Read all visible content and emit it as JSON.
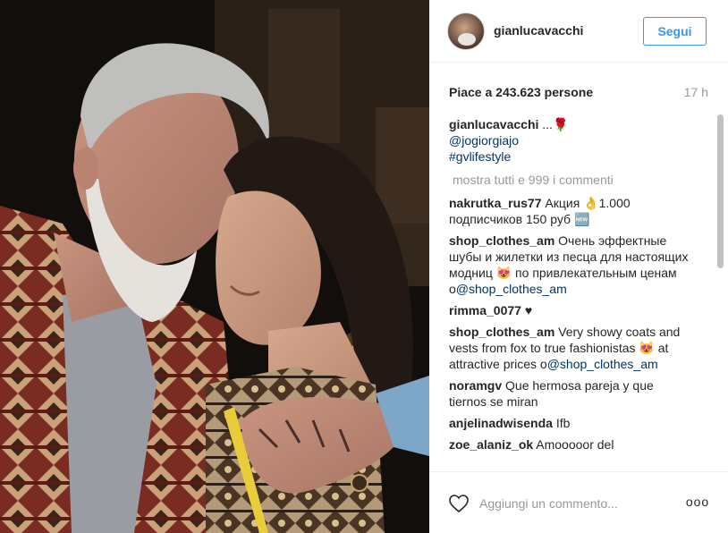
{
  "post": {
    "username": "gianlucavacchi",
    "follow_label": "Segui",
    "likes_text": "Piace a 243.623 persone",
    "time_ago": "17 h"
  },
  "caption": {
    "username": "gianlucavacchi",
    "text": " ...",
    "emoji": "🌹",
    "mention": "@jogiorgiajo",
    "hashtag": "#gvlifestyle"
  },
  "load_more": "mostra tutti e 999 i commenti",
  "comments": [
    {
      "user": "nakrutka_rus77",
      "text": " Акция ",
      "emoji1": "👌",
      "text2": "1.000 подписчиков 150 руб ",
      "emoji2": "🆕"
    },
    {
      "user": "shop_clothes_am",
      "text": " Очень эффектные шубы и жилетки из песца для настоящих модниц ",
      "emoji": "😻",
      "text2": " по привлекательным ценам о",
      "mention": "@shop_clothes_am"
    },
    {
      "user": "rimma_0077",
      "text": " ♥"
    },
    {
      "user": "shop_clothes_am",
      "text": " Very showy coats and vests from fox to true fashionistas ",
      "emoji": "😻",
      "text2": " at attractive prices о",
      "mention": "@shop_clothes_am"
    },
    {
      "user": "noramgv",
      "text": " Que hermosa pareja y que tiernos se miran"
    },
    {
      "user": "anjelinadwisenda",
      "text": " Ifb"
    },
    {
      "user": "zoe_alaniz_ok",
      "text": " Amooooor del"
    }
  ],
  "footer": {
    "comment_placeholder": "Aggiungi un commento...",
    "more_label": "ooo",
    "heart_icon": "heart-outline-icon",
    "more_icon": "more-options-icon"
  }
}
